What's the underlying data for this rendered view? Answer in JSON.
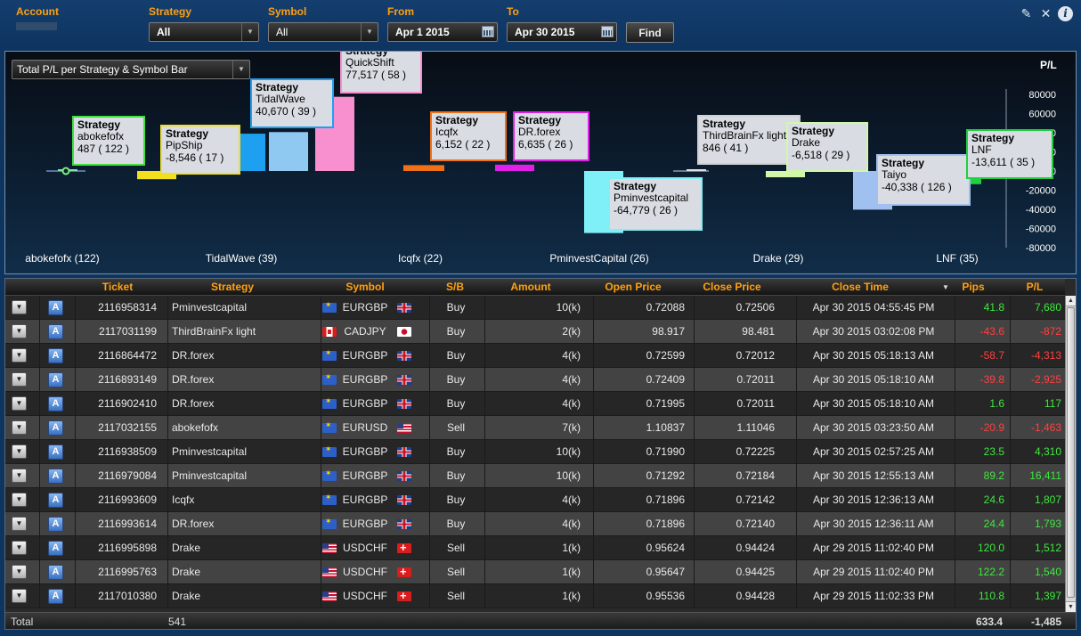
{
  "filters": {
    "account_label": "Account",
    "strategy_label": "Strategy",
    "strategy_value": "All",
    "symbol_label": "Symbol",
    "symbol_value": "All",
    "from_label": "From",
    "from_value": "Apr 1 2015",
    "to_label": "To",
    "to_value": "Apr 30 2015",
    "find_label": "Find"
  },
  "toolbar_icons": [
    "edit-icon",
    "excel-icon",
    "info-icon"
  ],
  "chart_select": "Total P/L per Strategy & Symbol Bar",
  "chart_data": {
    "type": "bar",
    "ylabel": "P/L",
    "ylim": [
      -80000,
      80000
    ],
    "yticks": [
      80000,
      60000,
      40000,
      20000,
      0,
      -20000,
      -40000,
      -60000,
      -80000
    ],
    "x_labels": [
      "abokefofx (122)",
      "TidalWave (39)",
      "Icqfx (22)",
      "PminvestCapital (26)",
      "Drake (29)",
      "LNF (35)"
    ],
    "bars": [
      {
        "strategy": "abokefofx",
        "value": 487,
        "trades": 122,
        "color": "#7cf07c"
      },
      {
        "strategy": "PipShip",
        "value": -8546,
        "trades": 17,
        "color": "#f0e020"
      },
      {
        "strategy": "",
        "value": 39000,
        "trades": null,
        "color": "#1ea0f0"
      },
      {
        "strategy": "TidalWave",
        "value": 40670,
        "trades": 39,
        "color": "#8fc8f0"
      },
      {
        "strategy": "QuickShift",
        "value": 77517,
        "trades": 58,
        "color": "#f890d0"
      },
      {
        "strategy": "Icqfx",
        "value": 6152,
        "trades": 22,
        "color": "#f07018"
      },
      {
        "strategy": "DR.forex",
        "value": 6635,
        "trades": 26,
        "color": "#e020e8"
      },
      {
        "strategy": "Pminvestcapital",
        "value": -64779,
        "trades": 26,
        "color": "#80f0f8"
      },
      {
        "strategy": "ThirdBrainFx light",
        "value": 846,
        "trades": 41,
        "color": "#e8e8e8"
      },
      {
        "strategy": "Drake",
        "value": -6518,
        "trades": 29,
        "color": "#d0f8a8"
      },
      {
        "strategy": "Taiyo",
        "value": -40338,
        "trades": 126,
        "color": "#a0c0f0"
      },
      {
        "strategy": "",
        "value": -13611,
        "trades": null,
        "color": "#c0f0c0"
      },
      {
        "strategy": "LNF",
        "value": -13611,
        "trades": 35,
        "color": "#20d040"
      }
    ],
    "tooltips": [
      {
        "header": "Strategy",
        "name": "abokefofx",
        "value": "487 ( 122 )",
        "border": "#40e040"
      },
      {
        "header": "Strategy",
        "name": "PipShip",
        "value": "-8,546 ( 17 )",
        "border": "#f0e020"
      },
      {
        "header": "Strategy",
        "name": "TidalWave",
        "value": "40,670 ( 39 )",
        "border": "#1ea0f0"
      },
      {
        "header": "Strategy",
        "name": "QuickShift",
        "value": "77,517 ( 58 )",
        "border": "#f890d0"
      },
      {
        "header": "Strategy",
        "name": "Icqfx",
        "value": "6,152 ( 22 )",
        "border": "#f07018"
      },
      {
        "header": "Strategy",
        "name": "DR.forex",
        "value": "6,635 ( 26 )",
        "border": "#e020e8"
      },
      {
        "header": "Strategy",
        "name": "Pminvestcapital",
        "value": "-64,779 ( 26 )",
        "border": "#80f0f8"
      },
      {
        "header": "Strategy",
        "name": "ThirdBrainFx light",
        "value": "846 ( 41 )",
        "border": "#d0d0d0"
      },
      {
        "header": "Strategy",
        "name": "Drake",
        "value": "-6,518 ( 29 )",
        "border": "#d0f8a8"
      },
      {
        "header": "Strategy",
        "name": "Taiyo",
        "value": "-40,338 ( 126 )",
        "border": "#a0c0f0"
      },
      {
        "header": "Strategy",
        "name": "LNF",
        "value": "-13,611 ( 35 )",
        "border": "#20d040"
      }
    ]
  },
  "table": {
    "columns": [
      "Ticket",
      "Strategy",
      "Symbol",
      "S/B",
      "Amount",
      "Open Price",
      "Close Price",
      "Close Time",
      "Pips",
      "P/L"
    ],
    "rows": [
      {
        "ticket": "2116958314",
        "strategy": "Pminvestcapital",
        "symbol": "EURGBP",
        "f1": "eu",
        "f2": "gb",
        "sb": "Buy",
        "amount": "10(k)",
        "open": "0.72088",
        "close": "0.72506",
        "time": "Apr 30 2015 04:55:45 PM",
        "pips": "41.8",
        "pl": "7,680",
        "sign": "pos"
      },
      {
        "ticket": "2117031199",
        "strategy": "ThirdBrainFx light",
        "symbol": "CADJPY",
        "f1": "ca",
        "f2": "jp",
        "sb": "Buy",
        "amount": "2(k)",
        "open": "98.917",
        "close": "98.481",
        "time": "Apr 30 2015 03:02:08 PM",
        "pips": "-43.6",
        "pl": "-872",
        "sign": "neg"
      },
      {
        "ticket": "2116864472",
        "strategy": "DR.forex",
        "symbol": "EURGBP",
        "f1": "eu",
        "f2": "gb",
        "sb": "Buy",
        "amount": "4(k)",
        "open": "0.72599",
        "close": "0.72012",
        "time": "Apr 30 2015 05:18:13 AM",
        "pips": "-58.7",
        "pl": "-4,313",
        "sign": "neg"
      },
      {
        "ticket": "2116893149",
        "strategy": "DR.forex",
        "symbol": "EURGBP",
        "f1": "eu",
        "f2": "gb",
        "sb": "Buy",
        "amount": "4(k)",
        "open": "0.72409",
        "close": "0.72011",
        "time": "Apr 30 2015 05:18:10 AM",
        "pips": "-39.8",
        "pl": "-2,925",
        "sign": "neg"
      },
      {
        "ticket": "2116902410",
        "strategy": "DR.forex",
        "symbol": "EURGBP",
        "f1": "eu",
        "f2": "gb",
        "sb": "Buy",
        "amount": "4(k)",
        "open": "0.71995",
        "close": "0.72011",
        "time": "Apr 30 2015 05:18:10 AM",
        "pips": "1.6",
        "pl": "117",
        "sign": "pos"
      },
      {
        "ticket": "2117032155",
        "strategy": "abokefofx",
        "symbol": "EURUSD",
        "f1": "eu",
        "f2": "us",
        "sb": "Sell",
        "amount": "7(k)",
        "open": "1.10837",
        "close": "1.11046",
        "time": "Apr 30 2015 03:23:50 AM",
        "pips": "-20.9",
        "pl": "-1,463",
        "sign": "neg"
      },
      {
        "ticket": "2116938509",
        "strategy": "Pminvestcapital",
        "symbol": "EURGBP",
        "f1": "eu",
        "f2": "gb",
        "sb": "Buy",
        "amount": "10(k)",
        "open": "0.71990",
        "close": "0.72225",
        "time": "Apr 30 2015 02:57:25 AM",
        "pips": "23.5",
        "pl": "4,310",
        "sign": "pos"
      },
      {
        "ticket": "2116979084",
        "strategy": "Pminvestcapital",
        "symbol": "EURGBP",
        "f1": "eu",
        "f2": "gb",
        "sb": "Buy",
        "amount": "10(k)",
        "open": "0.71292",
        "close": "0.72184",
        "time": "Apr 30 2015 12:55:13 AM",
        "pips": "89.2",
        "pl": "16,411",
        "sign": "pos"
      },
      {
        "ticket": "2116993609",
        "strategy": "Icqfx",
        "symbol": "EURGBP",
        "f1": "eu",
        "f2": "gb",
        "sb": "Buy",
        "amount": "4(k)",
        "open": "0.71896",
        "close": "0.72142",
        "time": "Apr 30 2015 12:36:13 AM",
        "pips": "24.6",
        "pl": "1,807",
        "sign": "pos"
      },
      {
        "ticket": "2116993614",
        "strategy": "DR.forex",
        "symbol": "EURGBP",
        "f1": "eu",
        "f2": "gb",
        "sb": "Buy",
        "amount": "4(k)",
        "open": "0.71896",
        "close": "0.72140",
        "time": "Apr 30 2015 12:36:11 AM",
        "pips": "24.4",
        "pl": "1,793",
        "sign": "pos"
      },
      {
        "ticket": "2116995898",
        "strategy": "Drake",
        "symbol": "USDCHF",
        "f1": "us",
        "f2": "ch",
        "sb": "Sell",
        "amount": "1(k)",
        "open": "0.95624",
        "close": "0.94424",
        "time": "Apr 29 2015 11:02:40 PM",
        "pips": "120.0",
        "pl": "1,512",
        "sign": "pos"
      },
      {
        "ticket": "2116995763",
        "strategy": "Drake",
        "symbol": "USDCHF",
        "f1": "us",
        "f2": "ch",
        "sb": "Sell",
        "amount": "1(k)",
        "open": "0.95647",
        "close": "0.94425",
        "time": "Apr 29 2015 11:02:40 PM",
        "pips": "122.2",
        "pl": "1,540",
        "sign": "pos"
      },
      {
        "ticket": "2117010380",
        "strategy": "Drake",
        "symbol": "USDCHF",
        "f1": "us",
        "f2": "ch",
        "sb": "Sell",
        "amount": "1(k)",
        "open": "0.95536",
        "close": "0.94428",
        "time": "Apr 29 2015 11:02:33 PM",
        "pips": "110.8",
        "pl": "1,397",
        "sign": "pos"
      }
    ],
    "total_label": "Total",
    "total_count": "541",
    "total_pips": "633.4",
    "total_pl": "-1,485"
  }
}
